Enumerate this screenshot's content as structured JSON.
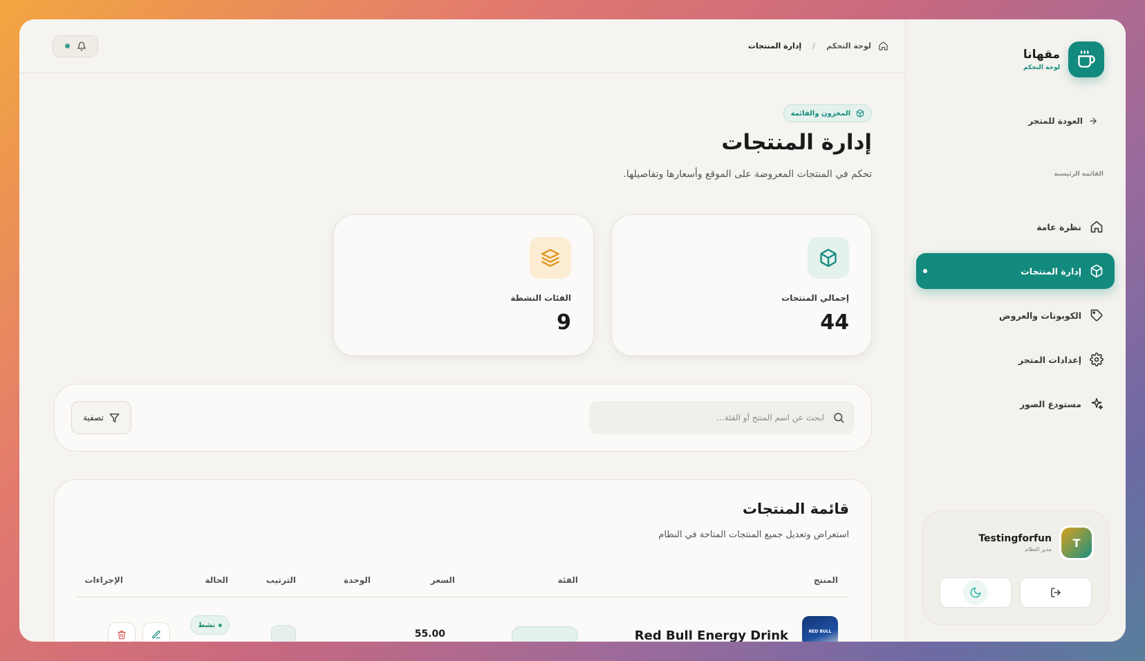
{
  "brand": {
    "name": "مقهانا",
    "subtitle": "لوحة التحكم"
  },
  "sidebar": {
    "back_label": "العودة للمتجر",
    "section_label": "القائمة الرئيسية",
    "items": [
      {
        "label": "نظرة عامة",
        "icon": "home-icon",
        "active": false
      },
      {
        "label": "إدارة المنتجات",
        "icon": "box-icon",
        "active": true
      },
      {
        "label": "الكوبونات والعروض",
        "icon": "tag-icon",
        "active": false
      },
      {
        "label": "إعدادات المتجر",
        "icon": "gear-icon",
        "active": false
      },
      {
        "label": "مستودع الصور",
        "icon": "sparkles-icon",
        "active": false
      }
    ]
  },
  "user": {
    "initial": "T",
    "name": "Testingforfun",
    "role": "مدير النظام"
  },
  "breadcrumb": {
    "home": "لوحة التحكم",
    "current": "إدارة المنتجات"
  },
  "header": {
    "badge": "المخزون والقائمة",
    "title": "إدارة المنتجات",
    "description": "تحكم في المنتجات المعروضة على الموقع وأسعارها وتفاصيلها."
  },
  "stats": [
    {
      "label": "إجمالي المنتجات",
      "value": "44",
      "icon": "box-icon",
      "color": "#138a7e"
    },
    {
      "label": "الفئات النشطة",
      "value": "9",
      "icon": "layers-icon",
      "color": "#e0961f"
    }
  ],
  "search": {
    "placeholder": "ابحث عن اسم المنتج أو الفئة..."
  },
  "filter": {
    "label": "تصفية"
  },
  "table": {
    "title": "قائمة المنتجات",
    "subtitle": "استعراض وتعديل جميع المنتجات المتاحة في النظام",
    "columns": [
      "المنتج",
      "الفئة",
      "السعر",
      "الوحدة",
      "الترتيب",
      "الحالة",
      "الإجراءات"
    ],
    "rows": [
      {
        "product": "Red Bull Energy Drink",
        "thumb_text": "RED BULL",
        "price": "55.00",
        "status": "نشط"
      }
    ]
  },
  "colors": {
    "accent": "#138a7e",
    "amber": "#e0961f",
    "danger": "#d9534f"
  }
}
